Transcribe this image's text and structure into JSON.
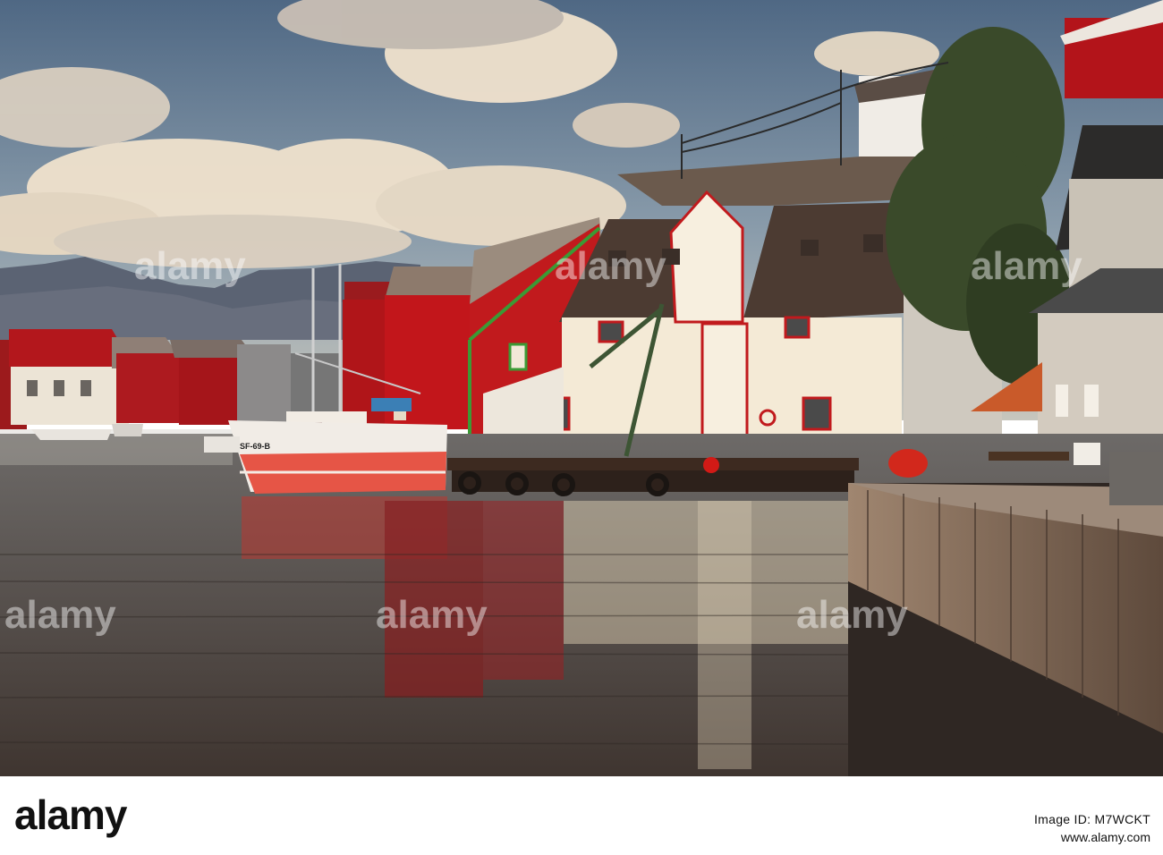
{
  "colors": {
    "sky_top": "#5b7390",
    "sky_low": "#b7c2c8",
    "cloud": "#f1e3cf",
    "mountain": "#5c6474",
    "water": "#6f6660",
    "red_wall": "#b8121a",
    "white_wall": "#f4ead8",
    "roof_dark": "#4d3c33",
    "boat_red": "#e7584a",
    "quay": "#7a6556",
    "tree": "#3a4a2a"
  },
  "watermark": {
    "text": "alamy",
    "repeats": 6
  },
  "boat": {
    "registration": "SF-69-B"
  },
  "footer": {
    "brand": "alamy",
    "image_id": "Image ID: M7WCKT",
    "url": "www.alamy.com"
  }
}
